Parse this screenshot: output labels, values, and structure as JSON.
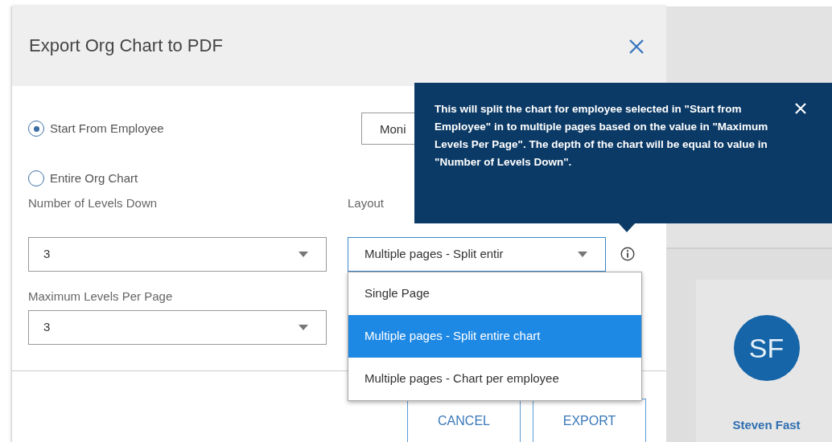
{
  "dialog": {
    "title": "Export Org Chart to PDF",
    "scope_options": [
      {
        "label": "Start From Employee",
        "selected": true
      },
      {
        "label": "Entire Org Chart",
        "selected": false
      }
    ],
    "employee_field": {
      "value": "Moni"
    },
    "levels_down": {
      "label": "Number of Levels Down",
      "value": "3"
    },
    "max_levels": {
      "label": "Maximum Levels Per Page",
      "value": "3"
    },
    "layout": {
      "label": "Layout",
      "value": "Multiple pages - Split entir",
      "expanded": true,
      "options": [
        {
          "label": "Single Page",
          "selected": false
        },
        {
          "label": "Multiple pages - Split entire chart",
          "selected": true
        },
        {
          "label": "Multiple pages - Chart per employee",
          "selected": false
        }
      ]
    },
    "tooltip": {
      "text": "This will split the chart for employee selected in \"Start from Employee\" in to multiple pages based on the value in \"Maximum Levels Per Page\". The depth of the chart will be equal to value in \"Number of Levels Down\"."
    },
    "buttons": [
      "CANCEL",
      "EXPORT"
    ]
  },
  "org_card": {
    "initials": "SF",
    "name": "Steven Fast"
  }
}
